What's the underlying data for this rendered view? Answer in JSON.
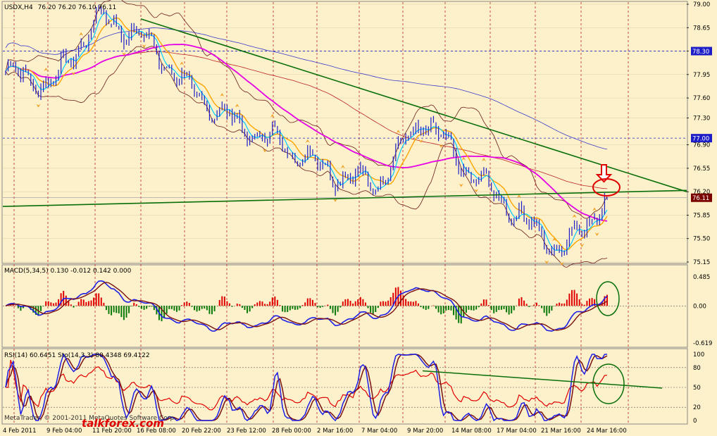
{
  "header": {
    "symbol_label": "USDX,H4",
    "ohlc": "76.20 76.20 76.10 76.11"
  },
  "price_panel": {
    "ticks": [
      "79.00",
      "78.65",
      "78.30",
      "77.95",
      "77.60",
      "77.30",
      "76.90",
      "76.55",
      "76.20",
      "75.85",
      "75.50",
      "75.15"
    ],
    "badges": [
      {
        "label": "78.30",
        "value": 78.3,
        "color": "#1e1ec8"
      },
      {
        "label": "77.00",
        "value": 77.0,
        "color": "#1e1ec8"
      },
      {
        "label": "76.11",
        "value": 76.11,
        "color": "#7a0000"
      }
    ]
  },
  "macd_panel": {
    "label": "MACD(5,34,5) 0.130 -0.012 0.142 0.000",
    "ticks": [
      "0.485",
      "0.00",
      "-0.619"
    ],
    "ylim": [
      -0.619,
      0.485
    ]
  },
  "osc_panel": {
    "label": "RSI(14) 60.6451  Sto(14,3,3) 80.4348 69.4122",
    "ticks": [
      "100",
      "80",
      "50",
      "20",
      "0"
    ]
  },
  "x_axis": {
    "labels": [
      "4 Feb 2011",
      "9 Feb 04:00",
      "11 Feb 20:00",
      "16 Feb 08:00",
      "20 Feb 22:00",
      "23 Feb 12:00",
      "28 Feb 00:00",
      "2 Mar 16:00",
      "7 Mar 04:00",
      "9 Mar 20:00",
      "14 Mar 08:00",
      "17 Mar 04:00",
      "21 Mar 16:00",
      "24 Mar 16:00"
    ]
  },
  "watermark": {
    "copyright": "MetaTrader, © 2001-2011 MetaQuotes Software Corp.",
    "site": "talkforex.com"
  },
  "colors": {
    "background": "#fcf1ca",
    "candle": "#1e1ec8",
    "trendline": "#0a6e0a",
    "ma_magenta": "#e600e6",
    "ma_orange": "#ffa500",
    "ma_cyan": "#00ccff",
    "bollinger": "#6b1a1a",
    "hist_up": "#e10000",
    "hist_down": "#0a7a0a",
    "annotation": "#e10000"
  },
  "chart_data": {
    "type": "line",
    "x": [
      "4 Feb 2011",
      "9 Feb 04:00",
      "11 Feb 20:00",
      "16 Feb 08:00",
      "20 Feb 22:00",
      "23 Feb 12:00",
      "28 Feb 00:00",
      "2 Mar 16:00",
      "7 Mar 04:00",
      "9 Mar 20:00",
      "14 Mar 08:00",
      "17 Mar 04:00",
      "21 Mar 16:00",
      "24 Mar 16:00"
    ],
    "series": [
      {
        "name": "USDX,H4",
        "values": [
          78.0,
          77.8,
          78.8,
          78.5,
          77.7,
          77.2,
          76.9,
          76.5,
          76.3,
          77.3,
          76.5,
          75.9,
          75.3,
          76.1
        ]
      }
    ],
    "ylim": [
      75.15,
      79.0
    ],
    "macd": {
      "label": "MACD(5,34,5)",
      "values": [
        0.13,
        -0.012,
        0.142,
        0.0
      ],
      "ylim": [
        -0.619,
        0.485
      ]
    },
    "rsi": {
      "label": "RSI(14)",
      "value": 60.6451
    },
    "stochastic": {
      "label": "Sto(14,3,3)",
      "values": [
        80.4348,
        69.4122
      ],
      "ylim": [
        0,
        100
      ]
    }
  }
}
